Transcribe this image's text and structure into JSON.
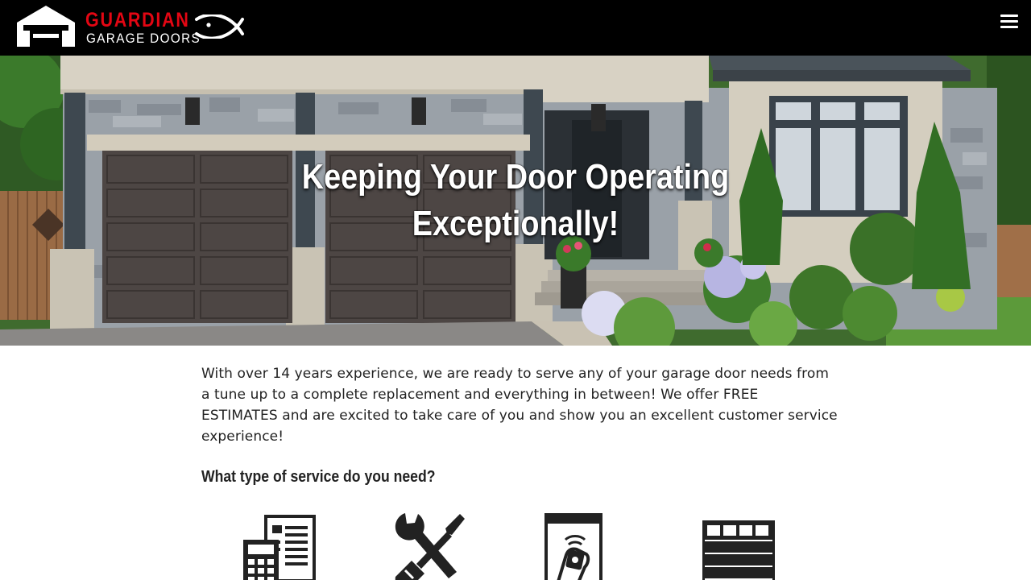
{
  "header": {
    "brand_primary": "GUARDIAN",
    "brand_secondary": "GARAGE DOORS",
    "icons": [
      "garage-logo-icon",
      "ichthys-fish-icon",
      "hamburger-menu-icon"
    ],
    "colors": {
      "background": "#000000",
      "brand_red": "#e30613",
      "text": "#ffffff"
    }
  },
  "hero": {
    "title_line1": "Keeping Your Door Operating",
    "title_line2": "Exceptionally!"
  },
  "content": {
    "intro": "With over 14 years experience, we are ready to serve any of your garage door needs from a tune up to a complete replacement and everything in between! We offer FREE ESTIMATES and are excited to take care of you and show you an excellent customer service experience!",
    "question": "What type of service do you need?",
    "services": [
      {
        "icon": "estimate-calculator-icon"
      },
      {
        "icon": "wrench-screwdriver-icon"
      },
      {
        "icon": "remote-opener-icon"
      },
      {
        "icon": "garage-door-icon"
      }
    ]
  }
}
